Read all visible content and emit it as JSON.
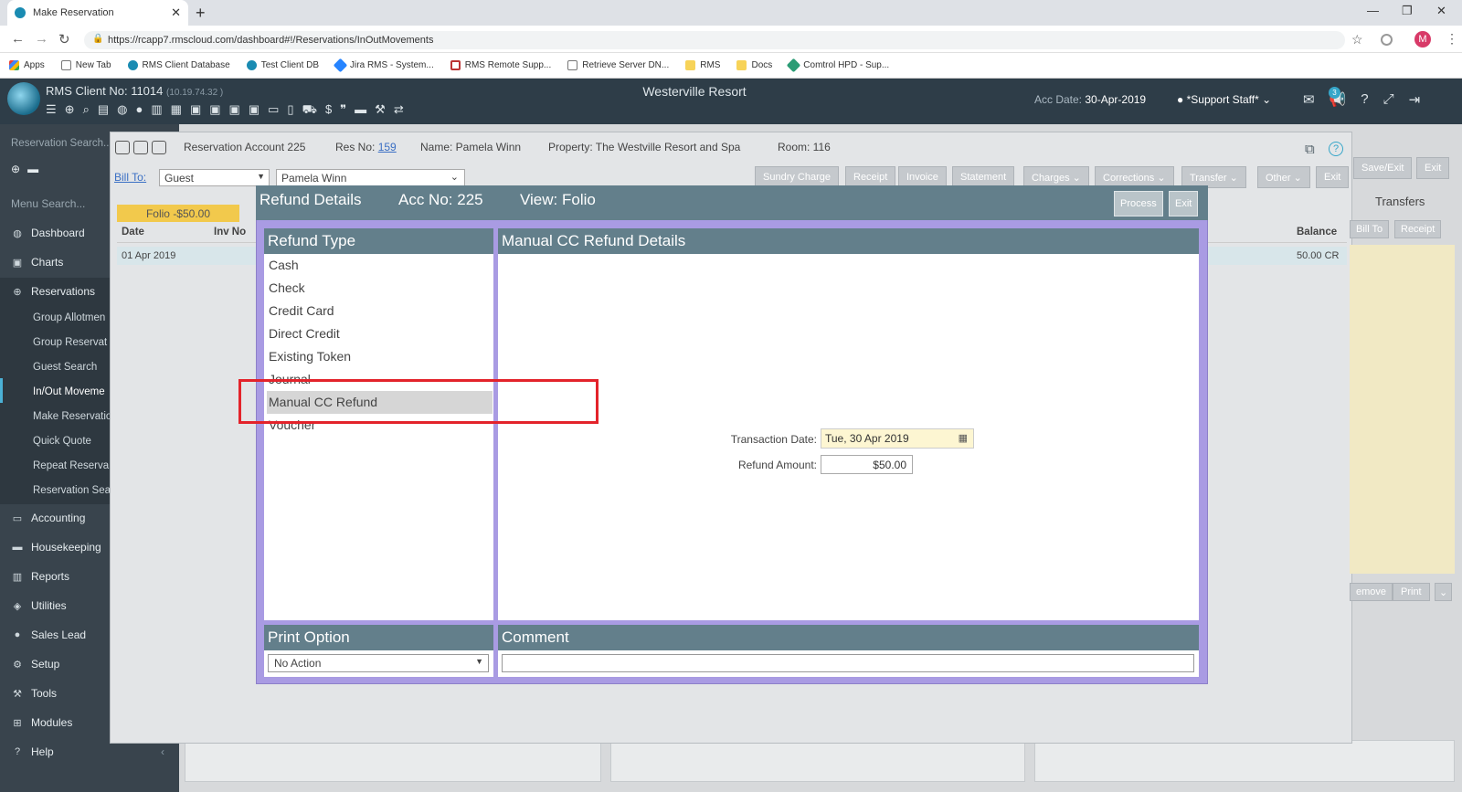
{
  "browser": {
    "tab_title": "Make Reservation",
    "url": "https://rcapp7.rmscloud.com/dashboard#!/Reservations/InOutMovements",
    "profile_initial": "M",
    "bookmarks": [
      "Apps",
      "New Tab",
      "RMS Client Database",
      "Test Client DB",
      "Jira RMS - System...",
      "RMS Remote Supp...",
      "Retrieve Server DN...",
      "RMS",
      "Docs",
      "Comtrol HPD - Sup..."
    ]
  },
  "header": {
    "client_label": "RMS Client No: 11014",
    "client_ip": "(10.19.74.32 )",
    "resort": "Westerville Resort",
    "acc_date_label": "Acc Date:",
    "acc_date": "30-Apr-2019",
    "staff": "*Support Staff*",
    "badge_count": "3"
  },
  "sidebar": {
    "search_label": "Reservation Search...",
    "menu_search": "Menu Search...",
    "items": [
      {
        "label": "Dashboard"
      },
      {
        "label": "Charts"
      },
      {
        "label": "Reservations"
      },
      {
        "label": "Group Allotmen"
      },
      {
        "label": "Group Reservat"
      },
      {
        "label": "Guest Search"
      },
      {
        "label": "In/Out Moveme"
      },
      {
        "label": "Make Reservatio"
      },
      {
        "label": "Quick Quote"
      },
      {
        "label": "Repeat Reserva"
      },
      {
        "label": "Reservation Sea"
      },
      {
        "label": "Accounting"
      },
      {
        "label": "Housekeeping"
      },
      {
        "label": "Reports"
      },
      {
        "label": "Utilities"
      },
      {
        "label": "Sales Lead"
      },
      {
        "label": "Setup"
      },
      {
        "label": "Tools"
      },
      {
        "label": "Modules"
      },
      {
        "label": "Help"
      }
    ]
  },
  "reservation": {
    "account": "Reservation Account 225",
    "res_no_label": "Res No:",
    "res_no": "159",
    "name": "Name: Pamela Winn",
    "property": "Property: The Westville Resort and Spa",
    "room": "Room: 116",
    "bill_to_label": "Bill To:",
    "bill_to": "Guest",
    "guest": "Pamela Winn",
    "buttons": [
      "Sundry Charge",
      "Receipt",
      "Invoice",
      "Statement",
      "Charges",
      "Corrections",
      "Transfer",
      "Other",
      "Exit"
    ],
    "right_buttons": [
      "Save/Exit",
      "Exit"
    ],
    "transfers_label": "Transfers",
    "bill_to_btn": "Bill To",
    "receipt_btn": "Receipt",
    "folio": "Folio -$50.00",
    "columns": {
      "date": "Date",
      "inv_no": "Inv No",
      "balance": "Balance"
    },
    "row": {
      "date": "01 Apr 2019",
      "balance": "50.00 CR"
    },
    "remove_btn": "emove",
    "print_btn": "Print"
  },
  "modal": {
    "title": "Refund Details",
    "acc_no": "Acc No: 225",
    "view": "View: Folio",
    "process": "Process",
    "exit": "Exit",
    "refund_type_header": "Refund Type",
    "refund_types": [
      "Cash",
      "Check",
      "Credit Card",
      "Direct Credit",
      "Existing Token",
      "Journal",
      "Manual CC Refund",
      "Voucher"
    ],
    "selected_type": "Manual CC Refund",
    "details_header": "Manual CC Refund Details",
    "transaction_date_label": "Transaction Date:",
    "transaction_date": "Tue, 30 Apr 2019",
    "refund_amount_label": "Refund Amount:",
    "refund_amount": "$50.00",
    "print_option_header": "Print Option",
    "print_option": "No Action",
    "comment_header": "Comment"
  },
  "colors": {
    "header_bg": "#2e3d48",
    "sidebar_bg": "#39444d",
    "modal_header": "#637f8b",
    "modal_border": "#a99be3",
    "highlight": "#e3232b",
    "folio": "#f2c94c"
  }
}
